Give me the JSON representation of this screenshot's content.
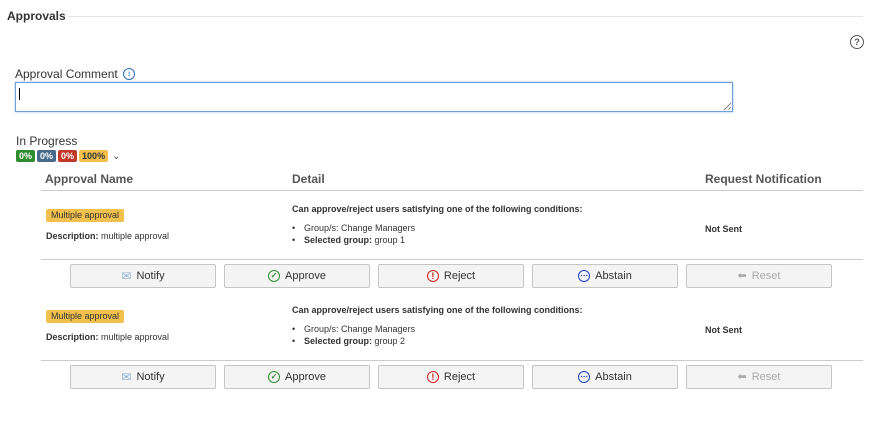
{
  "section": {
    "title": "Approvals"
  },
  "comment": {
    "label": "Approval Comment",
    "value": ""
  },
  "progress": {
    "label": "In Progress",
    "badges": [
      {
        "text": "0%",
        "color": "#2e8b2e"
      },
      {
        "text": "0%",
        "color": "#466a8c"
      },
      {
        "text": "0%",
        "color": "#c0392b"
      },
      {
        "text": "100%",
        "color": "#f2c04d"
      }
    ]
  },
  "table": {
    "headers": {
      "name": "Approval Name",
      "detail": "Detail",
      "notification": "Request Notification"
    }
  },
  "rows": [
    {
      "type": "Multiple approval",
      "desc_label": "Description:",
      "desc_value": " multiple approval",
      "condition_title": "Can approve/reject users satisfying one of the following conditions:",
      "cond1_label": "Group/s:",
      "cond1_value": " Change Managers",
      "cond2_label": "Selected group:",
      "cond2_value": " group 1",
      "notification": "Not Sent"
    },
    {
      "type": "Multiple approval",
      "desc_label": "Description:",
      "desc_value": " multiple approval",
      "condition_title": "Can approve/reject users satisfying one of the following conditions:",
      "cond1_label": "Group/s:",
      "cond1_value": " Change Managers",
      "cond2_label": "Selected group:",
      "cond2_value": " group 2",
      "notification": "Not Sent"
    }
  ],
  "buttons": {
    "notify": "Notify",
    "approve": "Approve",
    "reject": "Reject",
    "abstain": "Abstain",
    "reset": "Reset"
  }
}
